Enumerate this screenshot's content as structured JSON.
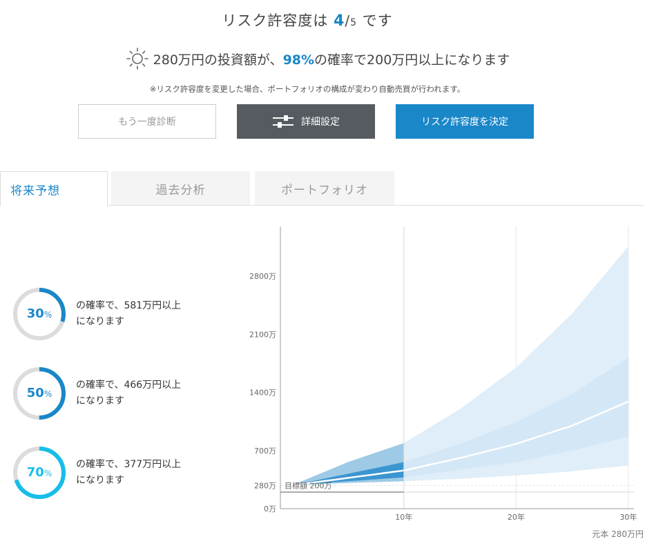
{
  "risk": {
    "prefix": "リスク許容度は ",
    "level": "4",
    "slash": "/",
    "max": "5",
    "suffix": " です"
  },
  "summary": {
    "prefix": "280万円の投資額が、",
    "percent": "98%",
    "suffix": "の確率で200万円以上になります",
    "icon": "sun-icon"
  },
  "note": "※リスク許容度を変更した場合、ポートフォリオの構成が変わり自動売買が行われます。",
  "buttons": {
    "retry": "もう一度診断",
    "detail": "詳細設定",
    "decide": "リスク許容度を決定"
  },
  "tabs": [
    {
      "label": "将来予想",
      "active": true
    },
    {
      "label": "過去分析",
      "active": false
    },
    {
      "label": "ポートフォリオ",
      "active": false
    }
  ],
  "probabilities": [
    {
      "value": "30",
      "unit": "%",
      "fraction": 0.3,
      "color": "#1a87c9",
      "line1": "の確率で、581万円以上",
      "line2": "になります"
    },
    {
      "value": "50",
      "unit": "%",
      "fraction": 0.5,
      "color": "#1a87c9",
      "line1": "の確率で、466万円以上",
      "line2": "になります"
    },
    {
      "value": "70",
      "unit": "%",
      "fraction": 0.7,
      "color": "#17bde8",
      "line1": "の確率で、377万円以上",
      "line2": "になります"
    }
  ],
  "chart_data": {
    "type": "area",
    "xlabel": "",
    "ylabel": "",
    "x_ticks": [
      "10年",
      "20年",
      "30年"
    ],
    "x_tick_values": [
      10,
      20,
      30
    ],
    "y_ticks": [
      "0万",
      "280万",
      "700万",
      "1400万",
      "2100万",
      "2800万"
    ],
    "y_tick_values": [
      0,
      280,
      700,
      1400,
      2100,
      2800
    ],
    "ylim": [
      0,
      3400
    ],
    "xlim": [
      -1,
      30.5
    ],
    "target_label": "目標額 200万",
    "target_value": 200,
    "principal_value": 280,
    "highlight_until_year": 10,
    "years": [
      0,
      5,
      10,
      15,
      20,
      25,
      30
    ],
    "bands": {
      "upper_outer": [
        280,
        560,
        790,
        1200,
        1700,
        2350,
        3160
      ],
      "upper_inner": [
        280,
        420,
        560,
        780,
        1040,
        1380,
        1820
      ],
      "median": [
        280,
        370,
        460,
        610,
        780,
        1000,
        1290
      ],
      "lower_inner": [
        280,
        330,
        377,
        470,
        560,
        700,
        870
      ],
      "lower_outer": [
        280,
        310,
        330,
        360,
        400,
        450,
        520
      ]
    },
    "colors": {
      "outer": "#dfeef8",
      "inner": "#b7d9f0",
      "outer_recent": "#9ecae6",
      "inner_recent": "#3b95d0",
      "median": "#ffffff"
    }
  },
  "principal_label": "元本 280万円"
}
